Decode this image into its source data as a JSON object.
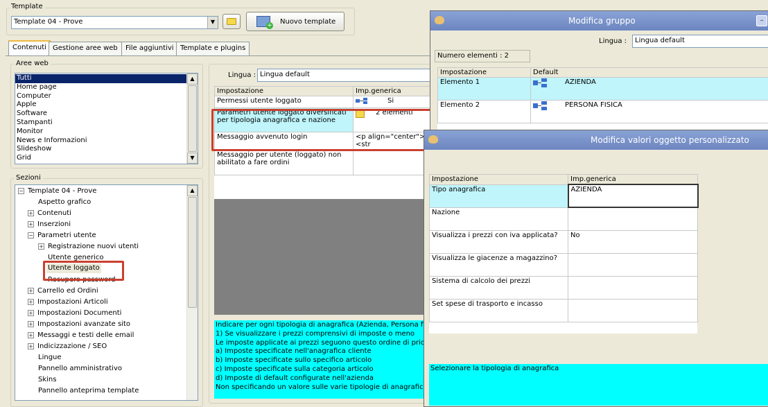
{
  "template_section": {
    "label": "Template",
    "selected": "Template 04 - Prove",
    "new_button": "Nuovo template"
  },
  "tabs": [
    "Contenuti",
    "Gestione aree web",
    "File aggiuntivi",
    "Template e plugins"
  ],
  "aree_web": {
    "label": "Aree web",
    "items": [
      "Tutti",
      "Home page",
      "Computer",
      "Apple",
      "Software",
      "Stampanti",
      "Monitor",
      "News e Informazioni",
      "Slideshow",
      "Grid"
    ]
  },
  "sezioni": {
    "label": "Sezioni",
    "items": [
      {
        "label": "Template 04 - Prove",
        "expander": "−"
      },
      {
        "label": "Aspetto grafico",
        "expander": ""
      },
      {
        "label": "Contenuti",
        "expander": "+"
      },
      {
        "label": "Inserzioni",
        "expander": "+"
      },
      {
        "label": "Parametri utente",
        "expander": "−"
      },
      {
        "label": "Registrazione nuovi utenti",
        "expander": "+"
      },
      {
        "label": "Utente generico",
        "expander": ""
      },
      {
        "label": "Utente loggato",
        "expander": ""
      },
      {
        "label": "Recupero password",
        "expander": ""
      },
      {
        "label": "Carrello ed Ordini",
        "expander": "+"
      },
      {
        "label": "Impostazioni Articoli",
        "expander": "+"
      },
      {
        "label": "Impostazioni Documenti",
        "expander": "+"
      },
      {
        "label": "Impostazioni avanzate sito",
        "expander": "+"
      },
      {
        "label": "Messaggi e testi delle email",
        "expander": "+"
      },
      {
        "label": "Indicizzazione / SEO",
        "expander": "+"
      },
      {
        "label": "Lingue",
        "expander": ""
      },
      {
        "label": "Pannello amministrativo",
        "expander": ""
      },
      {
        "label": "Skins",
        "expander": ""
      },
      {
        "label": "Pannello anteprima template",
        "expander": ""
      }
    ]
  },
  "main": {
    "lingua_label": "Lingua :",
    "lingua_value": "Lingua default",
    "headers": [
      "Impostazione",
      "Imp.generica"
    ],
    "rows": [
      {
        "name": "Permessi utente loggato",
        "value": "Si"
      },
      {
        "name": "Parametri utente loggato diversificati per tipologia anagrafica e nazione",
        "value": "2 elementi"
      },
      {
        "name": "Messaggio avvenuto login",
        "value": "<p align=\"center\"><str"
      },
      {
        "name": "Messaggio per utente (loggato) non abilitato a fare ordini",
        "value": ""
      }
    ],
    "description": [
      "Indicare per ogni tipologia di anagrafica (Azienda, Persona fisic",
      "1) Se visualizzare i prezzi comprensivi di imposte o meno",
      "Le imposte applicate ai prezzi seguono questo ordine di priorità",
      "a) Imposte specificate nell'anagrafica cliente",
      "b) Imposte specificate sullo specifico articolo",
      "c) Imposte specificate sulla categoria articolo",
      "d) Imposte di default configurate nell'azienda",
      "Non specificando un valore sulle varie tipologie di anagrafica il"
    ]
  },
  "modifica_gruppo": {
    "title": "Modifica gruppo",
    "lingua_label": "Lingua :",
    "lingua_value": "Lingua default",
    "count_label": "Numero elementi : 2",
    "headers": [
      "Impostazione",
      "Default"
    ],
    "rows": [
      {
        "name": "Elemento 1",
        "value": "AZIENDA"
      },
      {
        "name": "Elemento 2",
        "value": "PERSONA FISICA"
      }
    ]
  },
  "modifica_valori": {
    "title": "Modifica valori oggetto personalizzato",
    "headers": [
      "Impostazione",
      "Imp.generica"
    ],
    "rows": [
      {
        "name": "Tipo anagrafica",
        "value": "AZIENDA"
      },
      {
        "name": "Nazione",
        "value": ""
      },
      {
        "name": "Visualizza i prezzi con iva applicata?",
        "value": "No"
      },
      {
        "name": "Visualizza le giacenze a magazzino?",
        "value": ""
      },
      {
        "name": "Sistema di calcolo dei prezzi",
        "value": ""
      },
      {
        "name": "Set spese di trasporto e incasso",
        "value": ""
      }
    ],
    "description": "Selezionare la tipologia di anagrafica"
  },
  "colors": {
    "highlight_box": "#c9402f",
    "selected_row": "#bff5fb",
    "description_bg": "#00ffff",
    "titlebar": "#7891c8"
  }
}
